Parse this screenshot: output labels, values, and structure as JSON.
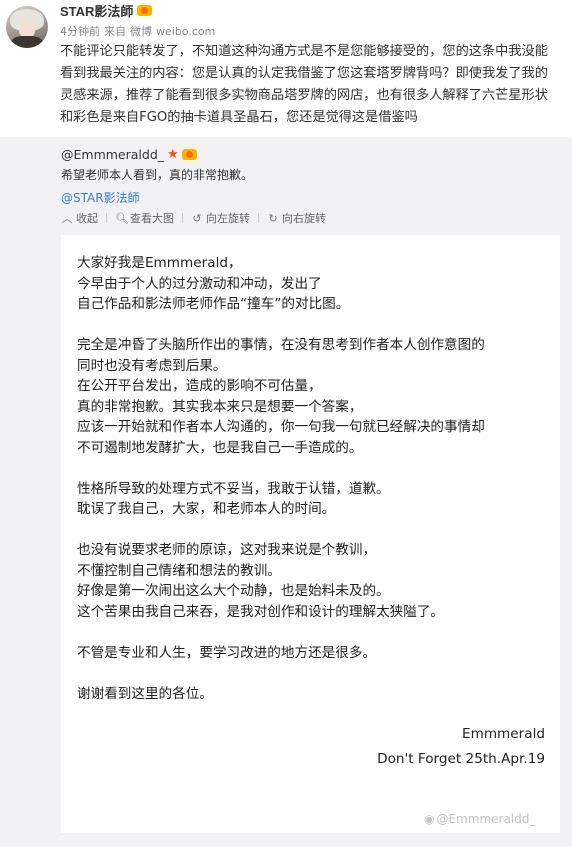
{
  "post": {
    "author": "STAR影法師",
    "meta": {
      "time": "4分钟前",
      "source_prefix": "来自",
      "source": "微博",
      "domain": "weibo.com"
    },
    "text": "不能评论只能转发了，不知道这种沟通方式是不是您能够接受的，您的这条中我没能看到我最关注的内容：您是认真的认定我借鉴了您这套塔罗牌背吗？即使我发了我的灵感来源，推荐了能看到很多实物商品塔罗牌的网店，也有很多人解释了六芒星形状和彩色是来自FGO的抽卡道具圣晶石，您还是觉得这是借鉴吗"
  },
  "repost": {
    "author": "@Emmmeraldd_",
    "text": "希望老师本人看到，真的非常抱歉。",
    "mention": "@STAR影法師",
    "toolbar": {
      "collapse": "收起",
      "view_large": "查看大图",
      "rotate_left": "向左旋转",
      "rotate_right": "向右旋转"
    },
    "letter": {
      "paragraphs": [
        [
          "大家好我是Emmmerald，",
          "今早由于个人的过分激动和冲动，发出了",
          "自己作品和影法师老师作品“撞车”的对比图。"
        ],
        [
          "完全是冲昏了头脑所作出的事情，在没有思考到作者本人创作意图的",
          "同时也没有考虑到后果。",
          "在公开平台发出，造成的影响不可估量，",
          "真的非常抱歉。其实我本来只是想要一个答案，",
          "应该一开始就和作者本人沟通的，你一句我一句就已经解决的事情却",
          "不可遏制地发酵扩大，也是我自己一手造成的。"
        ],
        [
          "性格所导致的处理方式不妥当，我敢于认错，道歉。",
          "耽误了我自己，大家，和老师本人的时间。"
        ],
        [
          "也没有说要求老师的原谅，这对我来说是个教训，",
          "不懂控制自己情绪和想法的教训。",
          "好像是第一次闹出这么大个动静，也是始料未及的。",
          "这个苦果由我自己来吞，是我对创作和设计的理解太狭隘了。"
        ],
        [
          "不管是专业和人生，要学习改进的地方还是很多。"
        ],
        [
          "谢谢看到这里的各位。"
        ]
      ],
      "signature_name": "Emmmerald",
      "signature_date": "Don't Forget 25th.Apr.19"
    },
    "watermark": "@Emmmeraldd_"
  },
  "icons": {
    "collapse": "chevron-up-icon",
    "view_large": "magnifier-icon",
    "rotate_left": "rotate-left-icon",
    "rotate_right": "rotate-right-icon",
    "star": "star-icon",
    "badge": "vip-badge-icon",
    "watermark": "weibo-logo-icon"
  },
  "colors": {
    "link": "#3a7bd5",
    "repost_background": "#f2f2f5",
    "star": "#ff4b1f",
    "badge": "#f7b500"
  }
}
